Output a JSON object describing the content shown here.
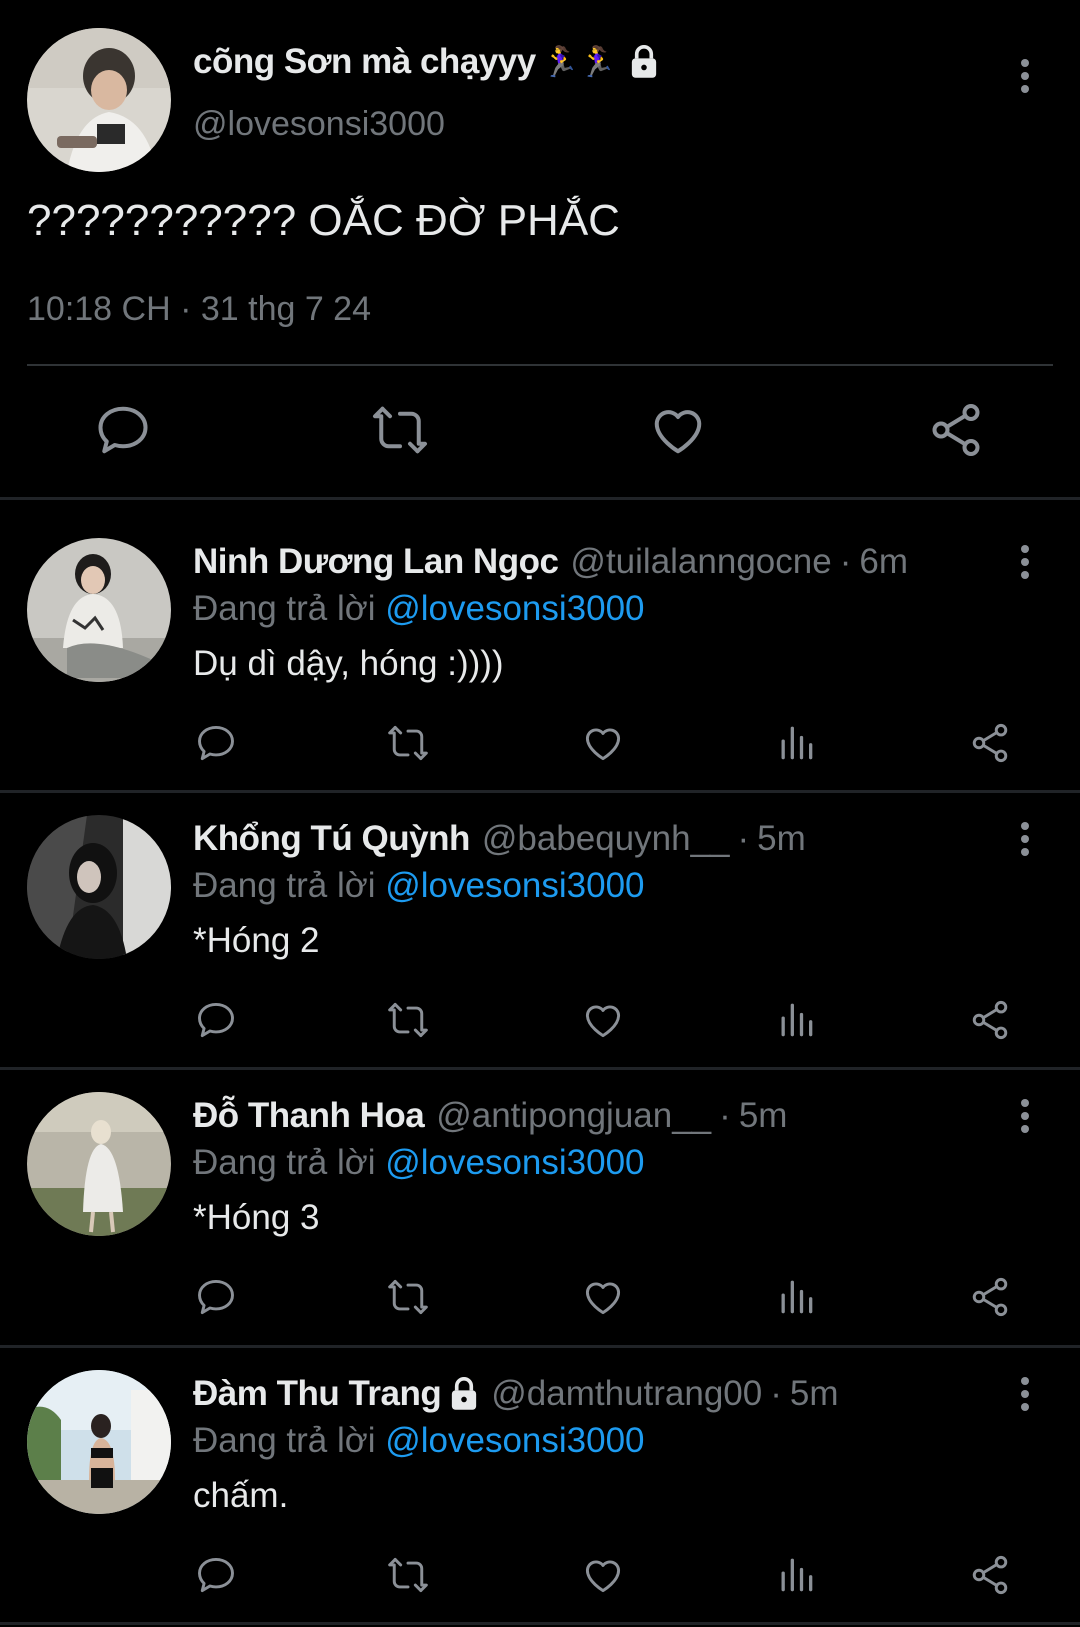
{
  "main_tweet": {
    "name": "cõng Sơn mà chạyyy",
    "name_emoji": "🏃‍♀️🏃‍♀️",
    "handle": "@lovesonsi3000",
    "text": "??????????? OẮC ĐỜ PHẮC",
    "timestamp": "10:18 CH · 31 thg 7 24"
  },
  "replies": [
    {
      "name": "Ninh Dương Lan Ngọc",
      "handle": "@tuilalanngocne",
      "dot": "·",
      "time": "6m",
      "replying_label": "Đang trả lời",
      "replying_to": "@lovesonsi3000",
      "text": "Dụ dì dậy, hóng :))))"
    },
    {
      "name": "Khổng Tú Quỳnh",
      "handle": "@babequynh__",
      "dot": "·",
      "time": "5m",
      "replying_label": "Đang trả lời",
      "replying_to": "@lovesonsi3000",
      "text": "*Hóng 2"
    },
    {
      "name": "Đỗ Thanh Hoa",
      "handle": "@antipongjuan__",
      "dot": "·",
      "time": "5m",
      "replying_label": "Đang trả lời",
      "replying_to": "@lovesonsi3000",
      "text": "*Hóng 3"
    },
    {
      "name": "Đàm Thu Trang",
      "handle": "@damthutrang00",
      "dot": "·",
      "time": "5m",
      "replying_label": "Đang trả lời",
      "replying_to": "@lovesonsi3000",
      "text": "chấm."
    }
  ],
  "icons": {
    "reply": "reply-icon",
    "retweet": "retweet-icon",
    "like": "heart-icon",
    "views": "views-icon",
    "share": "share-icon",
    "more": "more-vertical-icon",
    "lock": "lock-icon"
  },
  "colors": {
    "background": "#000000",
    "text": "#e7e9ea",
    "muted": "#71767b",
    "mention": "#1d9bf0",
    "divider": "#2f3336"
  }
}
